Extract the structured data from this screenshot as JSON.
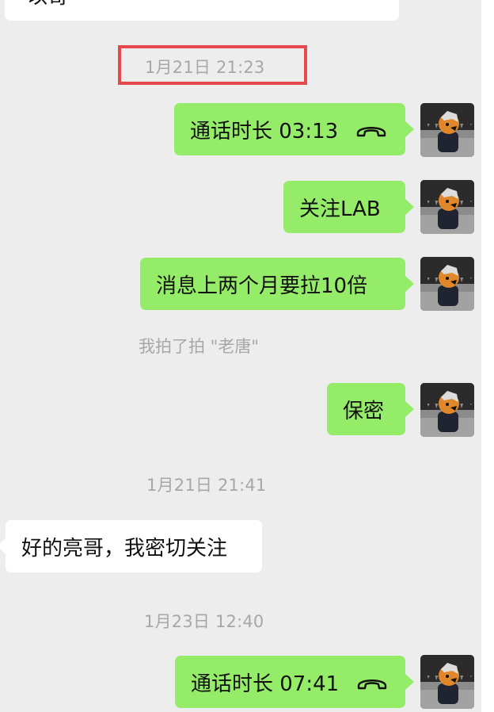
{
  "conversation": {
    "top_partial_text": "以哥",
    "timestamps": {
      "t1": "1月21日 21:23",
      "t2": "1月21日 21:41",
      "t3": "1月23日 12:40"
    },
    "messages": [
      {
        "type": "call",
        "text": "通话时长 03:13",
        "icon": "phone-hangup-icon",
        "side": "sent"
      },
      {
        "type": "text",
        "text": "关注LAB",
        "side": "sent"
      },
      {
        "type": "text",
        "text": "消息上两个月要拉10倍",
        "side": "sent"
      },
      {
        "type": "text",
        "text": "保密",
        "side": "sent"
      },
      {
        "type": "text",
        "text": "好的亮哥，我密切关注",
        "side": "received"
      },
      {
        "type": "call",
        "text": "通话时长 07:41",
        "icon": "phone-hangup-icon",
        "side": "sent"
      }
    ],
    "pat_notice": "我拍了拍 \"老唐\""
  },
  "colors": {
    "sent_bubble": "#95ec69",
    "received_bubble": "#ffffff",
    "chat_background": "#ededed",
    "timestamp_text": "#a7a7a7",
    "highlight_box": "#e5484d"
  }
}
